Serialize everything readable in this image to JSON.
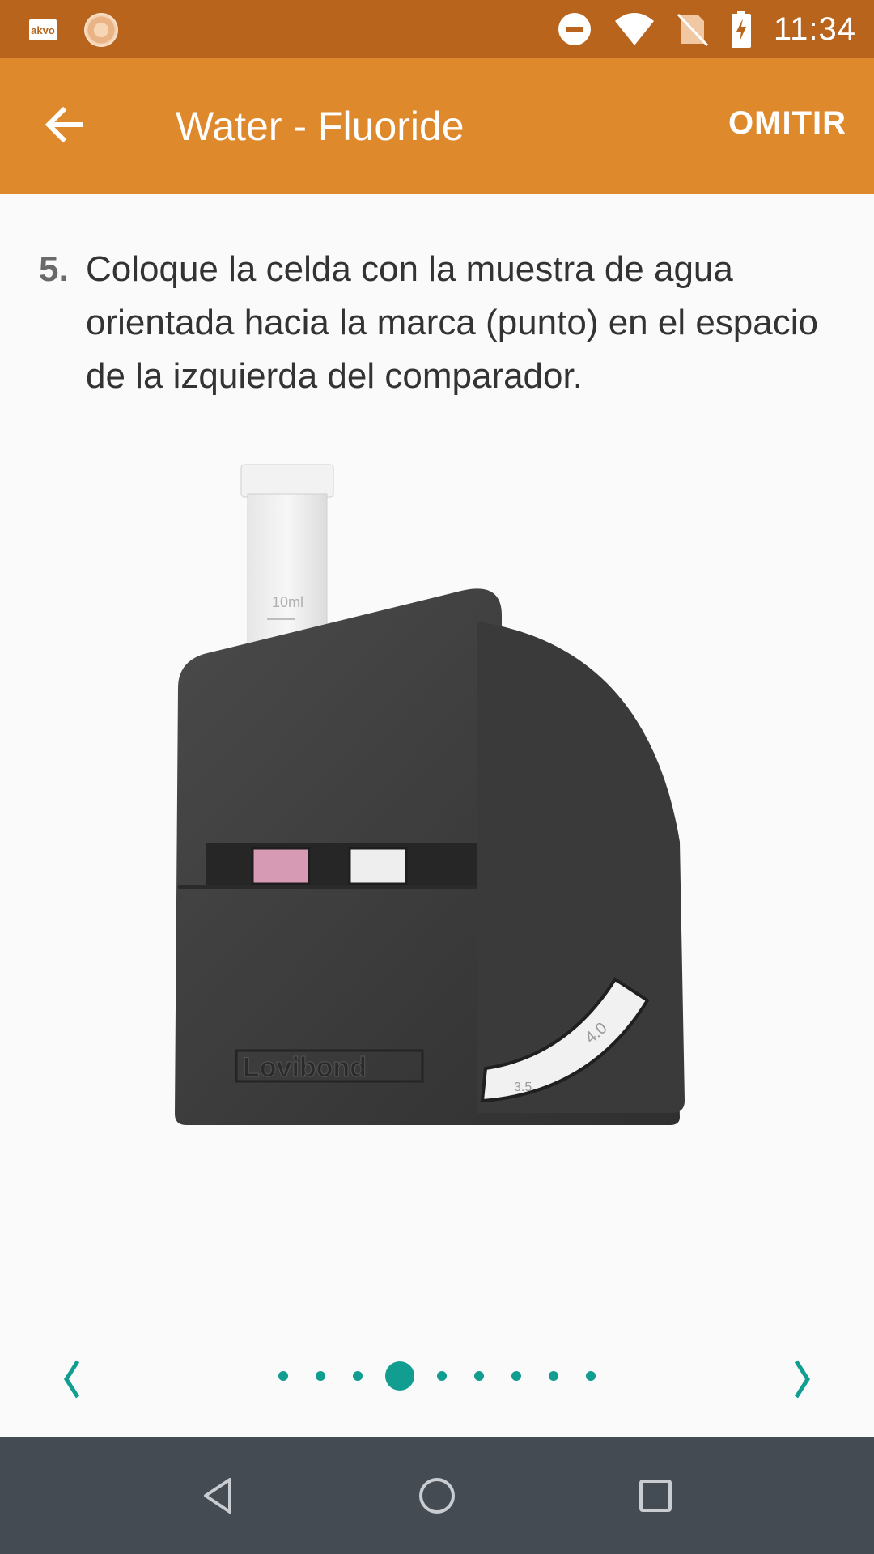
{
  "status_bar": {
    "time": "11:34",
    "app_badge_text": "akvo",
    "icons": [
      "akvo-app-icon",
      "sun-app-icon",
      "do-not-disturb-icon",
      "wifi-icon",
      "no-sim-icon",
      "battery-charging-icon"
    ]
  },
  "app_bar": {
    "title": "Water - Fluoride",
    "skip_label": "OMITIR",
    "back_icon": "arrow-left-icon"
  },
  "instruction": {
    "number": "5.",
    "text": "Coloque la celda con la muestra de agua orientada hacia la marca (punto) en el espacio de la izquierda del comparador."
  },
  "illustration": {
    "cell_label": "10ml",
    "brand_text": "Lovibond",
    "scale_values": [
      "3.5",
      "4.0"
    ]
  },
  "pager": {
    "total_pages": 9,
    "current_page": 4,
    "prev_icon": "chevron-left-icon",
    "next_icon": "chevron-right-icon",
    "accent_color": "#119e91"
  },
  "nav_bar": {
    "icons": [
      "nav-back-icon",
      "nav-home-icon",
      "nav-recents-icon"
    ]
  },
  "colors": {
    "status_bar": "#b8641d",
    "app_bar": "#df892d",
    "nav_bar": "#444b52",
    "accent": "#119e91"
  }
}
